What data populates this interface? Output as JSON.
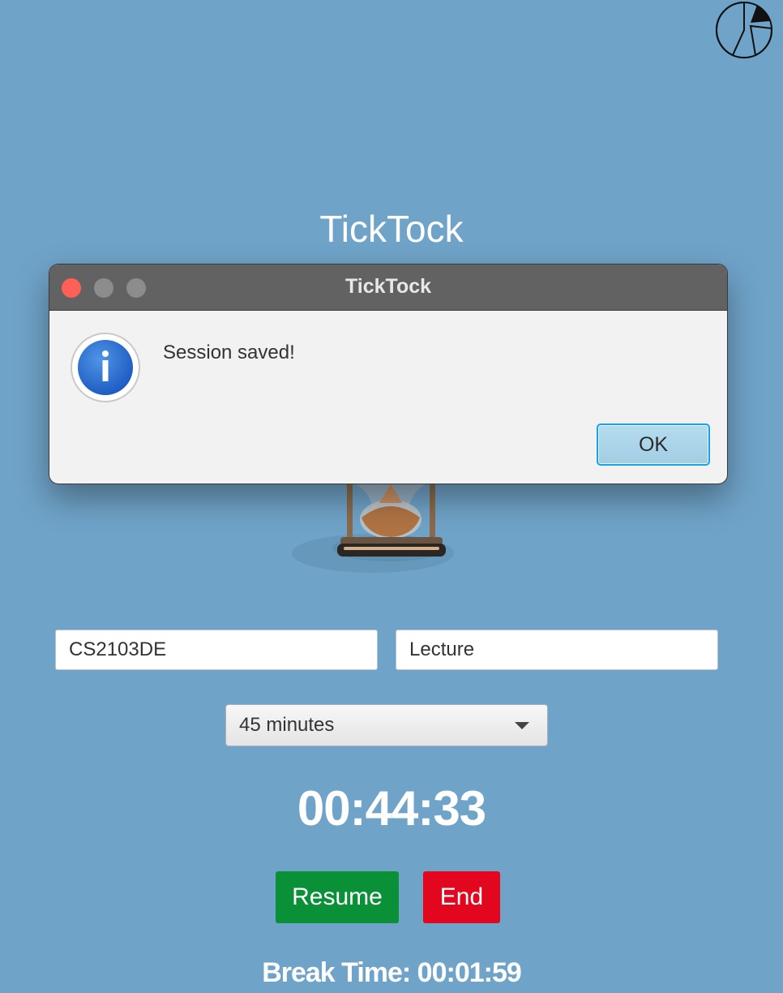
{
  "app": {
    "title": "TickTock"
  },
  "toolbar": {
    "stats_icon": "pie-chart-icon"
  },
  "form": {
    "course_value": "CS2103DE",
    "type_value": "Lecture",
    "duration_selected": "45 minutes"
  },
  "timer": {
    "display": "00:44:33"
  },
  "actions": {
    "resume_label": "Resume",
    "end_label": "End"
  },
  "break": {
    "text": "Break Time: 00:01:59"
  },
  "dialog": {
    "title": "TickTock",
    "message": "Session saved!",
    "icon": "info-icon",
    "ok_label": "OK"
  },
  "colors": {
    "background": "#6fa3c8",
    "resume_button": "#0a9137",
    "end_button": "#e3061f",
    "dialog_titlebar": "#626262",
    "ok_button_border": "#1aa3e3"
  }
}
